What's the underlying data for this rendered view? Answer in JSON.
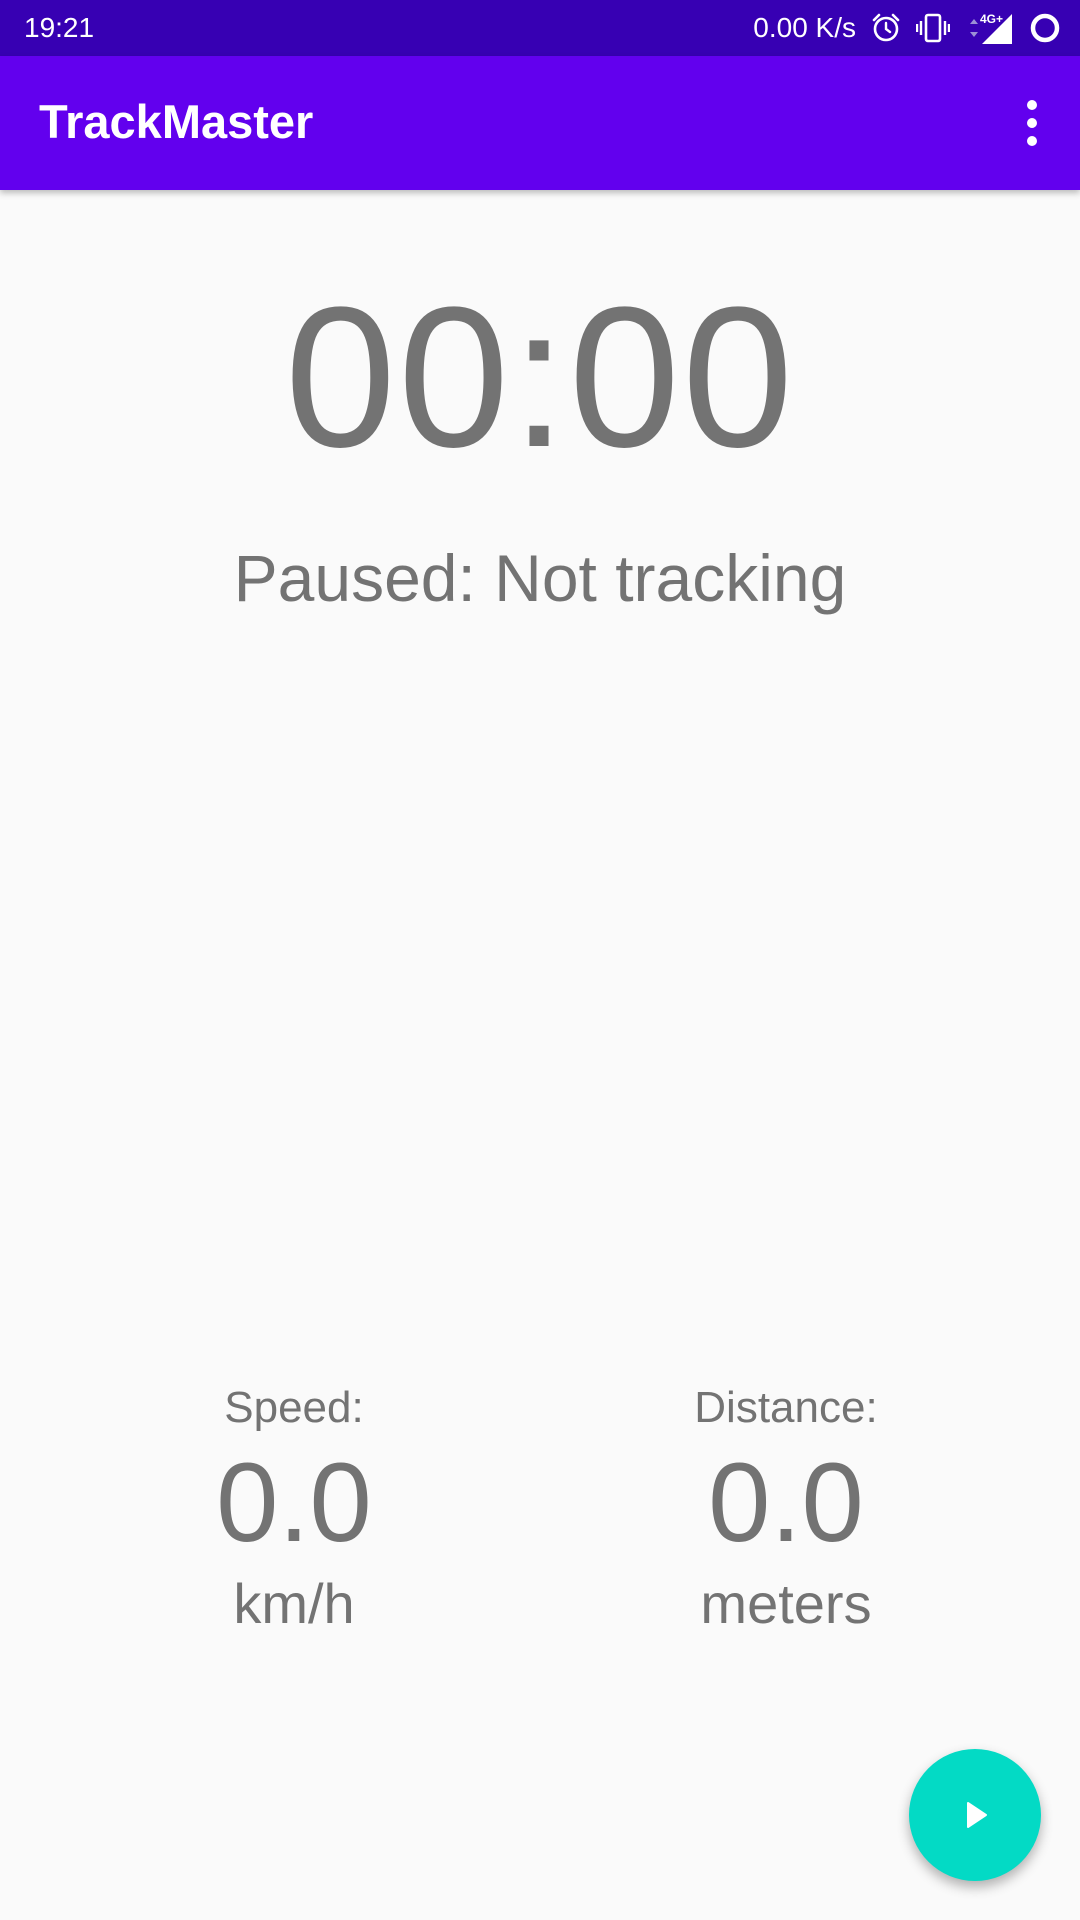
{
  "status_bar": {
    "time": "19:21",
    "net_speed": "0.00 K/s",
    "network_type": "4G+",
    "icons": [
      "alarm-icon",
      "vibrate-icon",
      "signal-icon",
      "loading-ring-icon"
    ]
  },
  "app_bar": {
    "title": "TrackMaster",
    "menu_icon": "more-vert-icon"
  },
  "timer": {
    "value": "00:00",
    "status": "Paused: Not tracking"
  },
  "stats": {
    "speed": {
      "label": "Speed:",
      "value": "0.0",
      "unit": "km/h"
    },
    "distance": {
      "label": "Distance:",
      "value": "0.0",
      "unit": "meters"
    }
  },
  "fab": {
    "icon": "play-icon"
  },
  "colors": {
    "status_bar": "#3700b3",
    "app_bar": "#6200ee",
    "fab": "#03dac5",
    "text": "#737373",
    "background": "#fafafa"
  }
}
